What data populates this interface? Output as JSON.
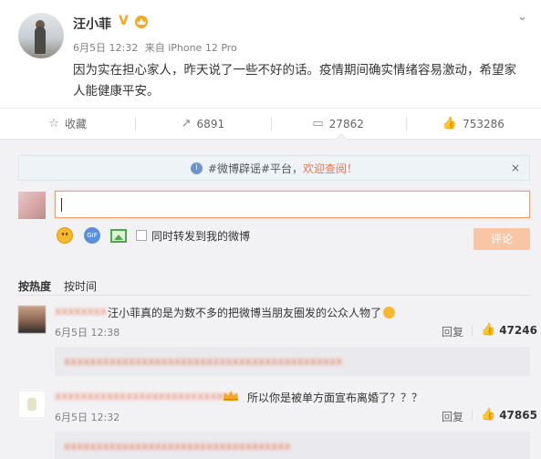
{
  "post": {
    "username": "汪小菲",
    "verified_mark": "V",
    "date": "6月5日 12:32",
    "source": "来自 iPhone 12 Pro",
    "text": "因为实在担心家人，昨天说了一些不好的话。疫情期间确实情绪容易激动，希望家人能健康平安。",
    "icons": {
      "verified": "verified-v-icon",
      "crown": "vip-crown-icon",
      "menu": "chevron-down-icon"
    }
  },
  "actions": {
    "favorite_label": "收藏",
    "repost_count": "6891",
    "comment_count": "27862",
    "like_count": "753286"
  },
  "notice": {
    "text": "#微博辟谣#平台，欢迎查阅！",
    "prefix": "#微博辟谣#平台，",
    "link": "欢迎查阅！",
    "close": "×"
  },
  "compose": {
    "input_value": "",
    "repost_label": "同时转发到我的微博",
    "submit_label": "评论",
    "gif_label": "GIF"
  },
  "sort": {
    "hot_label": "按热度",
    "time_label": "按时间"
  },
  "comments": [
    {
      "name": "[blurred]",
      "text": "汪小菲真的是为数不多的把微博当朋友圈发的公众人物了",
      "time": "6月5日 12:38",
      "reply_label": "回复",
      "likes": "47246",
      "sub_reply": "[blurred]"
    },
    {
      "name": "[blurred]",
      "text": "所以你是被单方面宣布离婚了？？？",
      "time": "6月5日 12:32",
      "reply_label": "回复",
      "likes": "47865",
      "sub_reply": "[blurred]"
    }
  ],
  "colors": {
    "accent": "#eb7350",
    "verified": "#f6a623",
    "input_border": "#f29b6c",
    "submit_bg": "#f8c6a5",
    "notice_bg": "#eef3f8"
  }
}
